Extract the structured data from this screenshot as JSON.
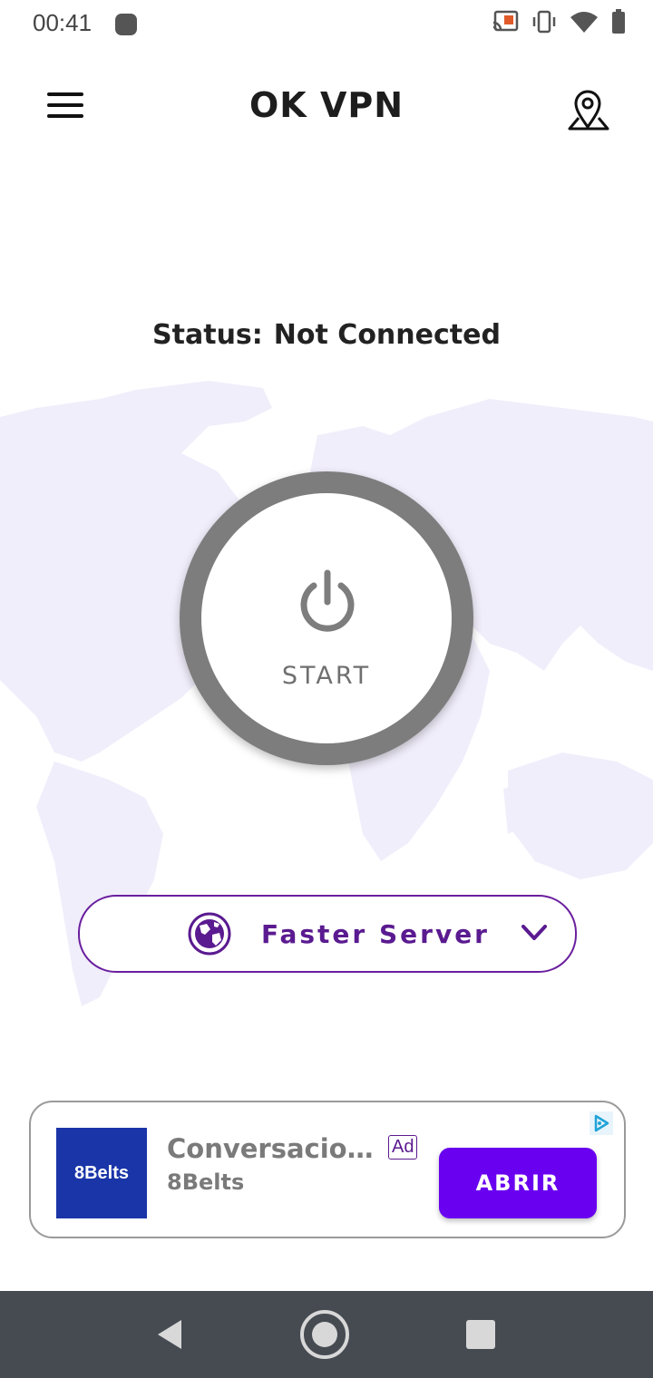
{
  "status_bar": {
    "time": "00:41"
  },
  "app_bar": {
    "title": "OK VPN"
  },
  "connection": {
    "status_label": "Status:",
    "status_value": "Not Connected"
  },
  "power_button": {
    "label": "START"
  },
  "server_selector": {
    "label": "Faster Server"
  },
  "ad": {
    "logo_text": "8Belts",
    "title": "Conversacion...",
    "badge": "Ad",
    "advertiser": "8Belts",
    "cta": "ABRIR"
  },
  "colors": {
    "accent_purple": "#5a1a90",
    "cta_purple": "#6a00f0",
    "ring_gray": "#7d7d7d",
    "map_tint": "#f1eefb",
    "nav_bar": "#464b52"
  },
  "icons": [
    "menu-icon",
    "location-pin-icon",
    "power-icon",
    "globe-icon",
    "chevron-down-icon",
    "ad-choices-icon",
    "back-icon",
    "home-icon",
    "recent-apps-icon",
    "cast-icon",
    "vibrate-icon",
    "wifi-icon",
    "battery-icon"
  ]
}
